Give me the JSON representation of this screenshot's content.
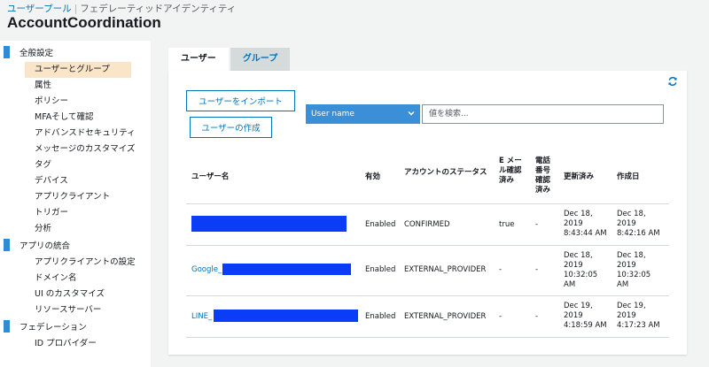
{
  "header": {
    "breadcrumb_link": "ユーザープール",
    "breadcrumb_current": "フェデレーティッドアイデンティティ",
    "app_title": "AccountCoordination"
  },
  "sidebar": {
    "sections": [
      {
        "label": "全般設定",
        "items": [
          "ユーザーとグループ",
          "属性",
          "ポリシー",
          "MFAそして確認",
          "アドバンスドセキュリティ",
          "メッセージのカスタマイズ",
          "タグ",
          "デバイス",
          "アプリクライアント",
          "トリガー",
          "分析"
        ]
      },
      {
        "label": "アプリの統合",
        "items": [
          "アプリクライアントの設定",
          "ドメイン名",
          "UI のカスタマイズ",
          "リソースサーバー"
        ]
      },
      {
        "label": "フェデレーション",
        "items": [
          "ID プロバイダー"
        ]
      }
    ]
  },
  "tabs": [
    "ユーザー",
    "グループ"
  ],
  "toolbar": {
    "import_label": "ユーザーをインポート",
    "create_label": "ユーザーの作成",
    "filter_selected": "User name",
    "search_placeholder": "値を検索..."
  },
  "table": {
    "headers": [
      "ユーザー名",
      "有効",
      "アカウントのステータス",
      "E メール確認済み",
      "電話番号確認済み",
      "更新済み",
      "作成日"
    ],
    "rows": [
      {
        "username_prefix": "",
        "enabled": "Enabled",
        "status": "CONFIRMED",
        "email_verified": "true",
        "phone_verified": "-",
        "updated": "Dec 18, 2019 8:43:44 AM",
        "created": "Dec 18, 2019 8:42:16 AM"
      },
      {
        "username_prefix": "Google_",
        "enabled": "Enabled",
        "status": "EXTERNAL_PROVIDER",
        "email_verified": "-",
        "phone_verified": "-",
        "updated": "Dec 18, 2019 10:32:05 AM",
        "created": "Dec 18, 2019 10:32:05 AM"
      },
      {
        "username_prefix": "LINE_",
        "enabled": "Enabled",
        "status": "EXTERNAL_PROVIDER",
        "email_verified": "-",
        "phone_verified": "-",
        "updated": "Dec 19, 2019 4:18:59 AM",
        "created": "Dec 19, 2019 4:17:23 AM"
      }
    ]
  },
  "colors": {
    "accent": "#0073bb",
    "select_bg": "#3b8fd6",
    "active_nav": "#fbe5c8",
    "redaction": "#0a3df5"
  },
  "icons": {
    "refresh": "refresh-icon",
    "dropdown": "chevron-down-icon"
  }
}
